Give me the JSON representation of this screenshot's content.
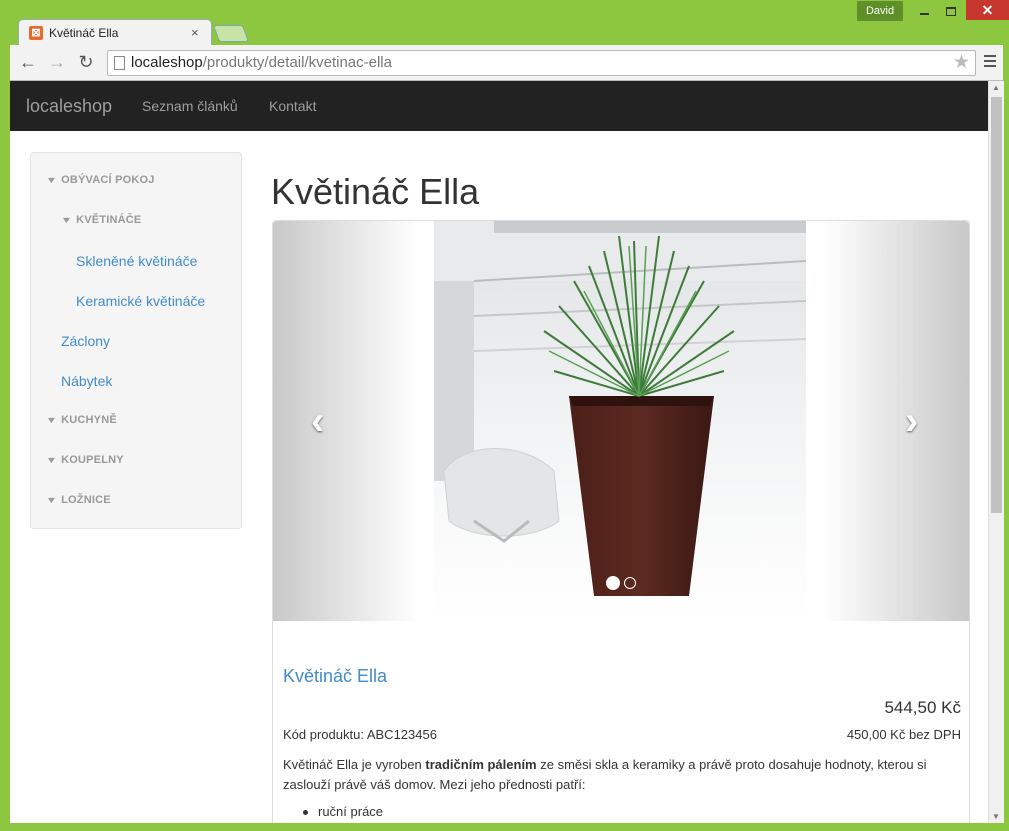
{
  "window": {
    "user": "David",
    "close_glyph": "✕"
  },
  "tab": {
    "title": "Květináč Ella",
    "close": "×"
  },
  "toolbar": {
    "url_host": "localeshop",
    "url_path": "/produkty/detail/kvetinac-ella",
    "back_glyph": "←",
    "forward_glyph": "→",
    "reload_glyph": "↻",
    "star_glyph": "★"
  },
  "site": {
    "brand": "localeshop",
    "nav": [
      "Seznam článků",
      "Kontakt"
    ]
  },
  "sidebar": {
    "items": [
      {
        "label": "OBÝVACÍ POKOJ",
        "type": "category"
      },
      {
        "label": "KVĚTINÁČE",
        "type": "category"
      },
      {
        "label": "Skleněné květináče",
        "type": "link"
      },
      {
        "label": "Keramické květináče",
        "type": "link"
      },
      {
        "label": "Záclony",
        "type": "link"
      },
      {
        "label": "Nábytek",
        "type": "link"
      },
      {
        "label": "KUCHYNĚ",
        "type": "category"
      },
      {
        "label": "KOUPELNY",
        "type": "category"
      },
      {
        "label": "LOŽNICE",
        "type": "category"
      }
    ],
    "chevron": "❯"
  },
  "product": {
    "heading": "Květináč Ella",
    "name": "Květináč Ella",
    "price": "544,50 Kč",
    "code": "Kód produktu: ABC123456",
    "price_net": "450,00 Kč bez DPH",
    "desc_before": "Květináč Ella je vyroben ",
    "desc_bold": "tradičním pálením",
    "desc_after": " ze směsi skla a keramiky a právě proto dosahuje hodnoty, kterou si zaslouží právě váš domov. Mezi jeho přednosti patří:",
    "features": [
      "ruční práce"
    ]
  },
  "carousel": {
    "prev_glyph": "‹",
    "next_glyph": "›",
    "slides": 2,
    "active_index": 0
  },
  "colors": {
    "navbar": "#222222",
    "link": "#428bca",
    "frame": "#8dc73f",
    "close": "#c7372f"
  }
}
